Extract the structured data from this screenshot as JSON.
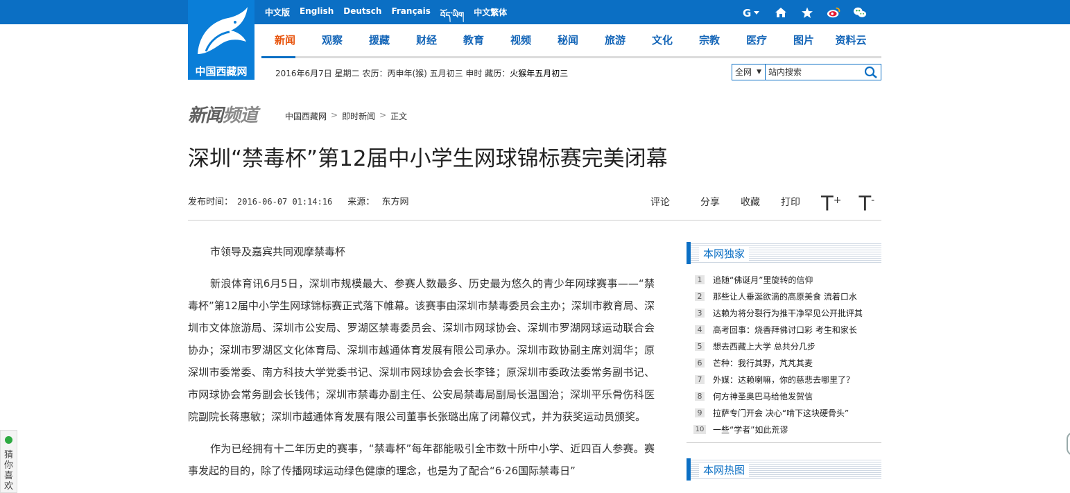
{
  "logo": {
    "text": "中国西藏网"
  },
  "languages": [
    "中文版",
    "English",
    "Deutsch",
    "Français",
    "བོད་ཡིག",
    "中文繁体"
  ],
  "top_icons": [
    "user-menu-icon",
    "home-icon",
    "star-icon",
    "weibo-icon",
    "wechat-icon"
  ],
  "nav": {
    "items": [
      "新闻",
      "观察",
      "援藏",
      "财经",
      "教育",
      "视频",
      "秘闻",
      "旅游",
      "文化",
      "宗教",
      "医疗",
      "图片",
      "资料云"
    ],
    "active_index": 0
  },
  "dateline": {
    "text": "2016年6月7日  星期二  农历：丙申年(猴) 五月初三  申时  藏历：",
    "tibetan": "火猴年五月初三"
  },
  "search": {
    "scope": "全网",
    "placeholder": "站内搜索"
  },
  "channel": {
    "logo_text": "新闻",
    "logo_text2": "频道"
  },
  "breadcrumb": [
    "中国西藏网",
    "即时新闻",
    "正文"
  ],
  "article": {
    "title": "深圳“禁毒杯”第12届中小学生网球锦标赛完美闭幕",
    "publish_label": "发布时间：",
    "publish_time": "2016-06-07 01:14:16",
    "source_label": "来源：",
    "source": "东方网",
    "tools": [
      "评论",
      "分享",
      "收藏",
      "打印"
    ],
    "font_up": "T",
    "font_down": "T",
    "paragraphs": [
      "市领导及嘉宾共同观摩禁毒杯",
      "新浪体育讯6月5日，深圳市规模最大、参赛人数最多、历史最为悠久的青少年网球赛事——“禁毒杯”第12届中小学生网球锦标赛正式落下帷幕。该赛事由深圳市禁毒委员会主办；深圳市教育局、深圳市文体旅游局、深圳市公安局、罗湖区禁毒委员会、深圳市网球协会、深圳市罗湖网球运动联合会协办；深圳市罗湖区文化体育局、深圳市越通体育发展有限公司承办。深圳市政协副主席刘润华；原深圳市委常委、南方科技大学党委书记、深圳市网球协会会长李锋；原深圳市委政法委常务副书记、市网球协会常务副会长钱伟；深圳市禁毒办副主任、公安局禁毒局副局长温国治；深圳平乐骨伤科医院副院长蒋惠敏；深圳市越通体育发展有限公司董事长张璐出席了闭幕仪式，并为获奖运动员颁奖。",
      "作为已经拥有十二年历史的赛事，“禁毒杯”每年都能吸引全市数十所中小学、近四百人参赛。赛事发起的目的，除了传播网球运动绿色健康的理念，也是为了配合“6·26国际禁毒日”"
    ]
  },
  "sidebar": {
    "exclusive_title": "本网独家",
    "exclusive_items": [
      "追随“佛诞月”里旋转的信仰",
      "那些让人垂涎欲滴的高原美食 流着口水",
      "达赖为将分裂行为推干净罕见公开批评其",
      "高考回事：烧香拜佛讨口彩 考生和家长",
      "想去西藏上大学 总共分几步",
      "芒种：我行其野，芃芃其麦",
      "外媒：达赖喇嘛，你的慈悲去哪里了？",
      "何方神圣奥巴马给他发贺信",
      "拉萨专门开会 决心“啃下这块硬骨头”",
      "一些“学者”如此荒谬"
    ],
    "hot_title": "本网热图"
  },
  "guess": {
    "text": "猜你喜欢"
  },
  "colors": {
    "brand_blue": "#0b6fc4",
    "active_orange": "#e8550e",
    "nav_blue": "#1566b8"
  }
}
